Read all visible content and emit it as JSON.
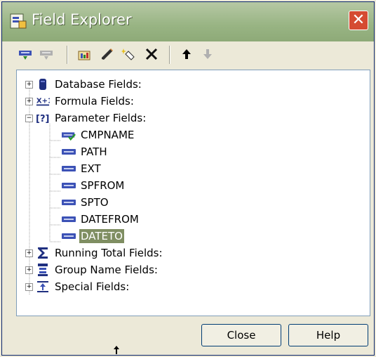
{
  "window": {
    "title": "Field Explorer",
    "close_glyph": "✕"
  },
  "toolbar": {
    "buttons": [
      {
        "name": "insert-to-report-icon",
        "enabled": true
      },
      {
        "name": "browse-icon",
        "enabled": false
      },
      {
        "name": "new-icon",
        "enabled": true
      },
      {
        "name": "edit-icon",
        "enabled": true
      },
      {
        "name": "rename-icon",
        "enabled": true
      },
      {
        "name": "delete-icon",
        "enabled": true
      },
      {
        "name": "move-up-icon",
        "enabled": true
      },
      {
        "name": "move-down-icon",
        "enabled": false
      }
    ]
  },
  "tree": {
    "database_fields": "Database Fields:",
    "formula_fields": "Formula Fields:",
    "parameter_fields": "Parameter Fields:",
    "parameters": [
      "CMPNAME",
      "PATH",
      "EXT",
      "SPFROM",
      "SPTO",
      "DATEFROM",
      "DATETO"
    ],
    "selected_parameter": "DATETO",
    "running_total_fields": "Running Total Fields:",
    "group_name_fields": "Group Name Fields:",
    "special_fields": "Special Fields:"
  },
  "buttons": {
    "close": "Close",
    "help": "Help"
  },
  "colors": {
    "title_gradient_top": "#b6c8a4",
    "close_button": "#d54b32",
    "selection": "#7f8e62",
    "parameter_icon": "#3c52b6"
  }
}
